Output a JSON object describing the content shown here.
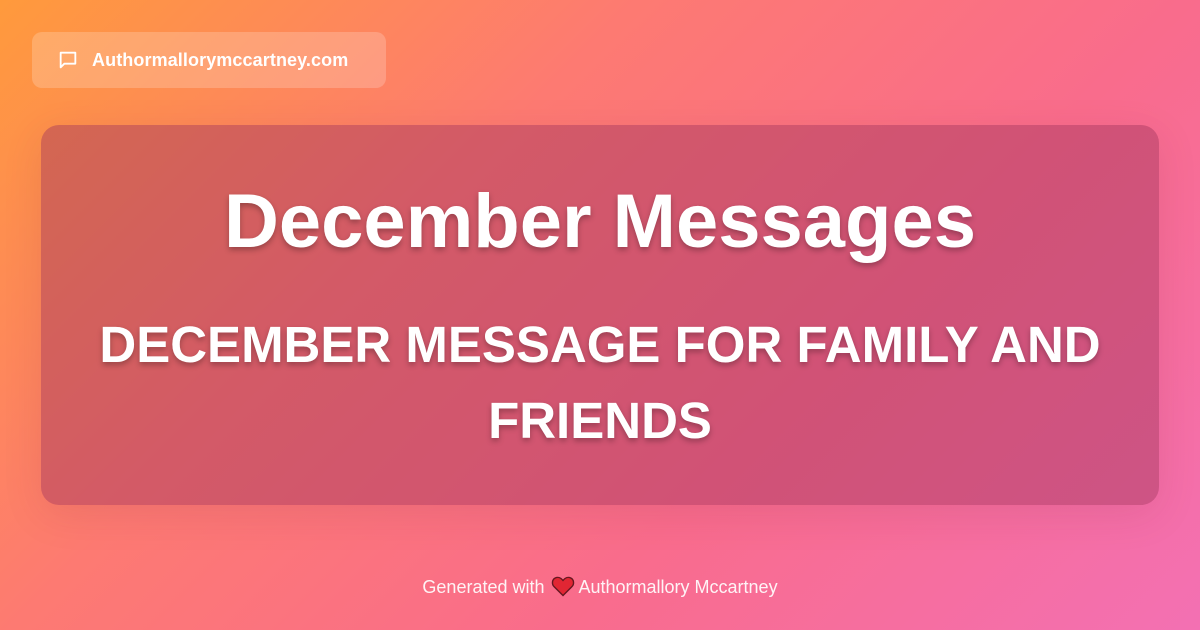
{
  "badge": {
    "icon": "chat-bubble-icon",
    "site": "Authormallorymccartney.com"
  },
  "card": {
    "title": "December Messages",
    "subtitle": "DECEMBER MESSAGE FOR FAMILY AND FRIENDS"
  },
  "footer": {
    "prefix": "Generated with",
    "icon": "heart-icon",
    "author": "Authormallory Mccartney"
  },
  "colors": {
    "gradient_start": "#ff9a3c",
    "gradient_end": "#f370b3",
    "text": "#ffffff",
    "heart": "#e0202c"
  }
}
